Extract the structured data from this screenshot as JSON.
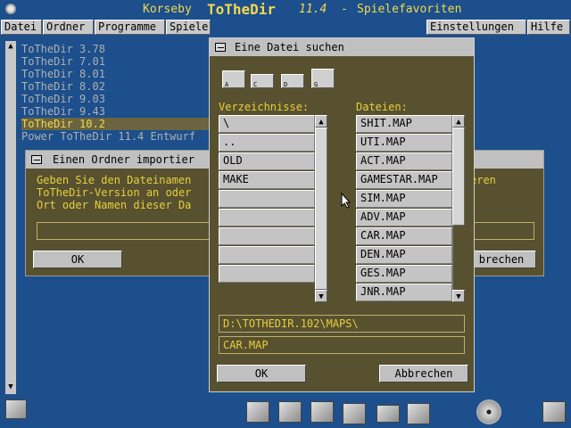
{
  "window": {
    "app_name": "Korseby",
    "product": "ToTheDir",
    "version": "11.4",
    "separator": "-",
    "subtitle": "Spielefavoriten"
  },
  "menu": {
    "left": [
      "Datei",
      "Ordner",
      "Programme",
      "Spiele"
    ],
    "right": [
      "Einstellungen",
      "Hilfe"
    ]
  },
  "main_list": {
    "items": [
      "ToTheDir 3.78",
      "ToTheDir 7.01",
      "ToTheDir 8.01",
      "ToTheDir 8.02",
      "ToTheDir 9.03",
      "ToTheDir 9.43",
      "ToTheDir 10.2",
      "Power ToTheDir 11.4 Entwurf"
    ],
    "selected_index": 6,
    "scroll_up": "▲",
    "scroll_down": "▼"
  },
  "import_dialog": {
    "title": "Einen Ordner importier",
    "text_lines": [
      "Geben Sie den Dateinamen",
      "ToTheDir-Version an oder",
      "Ort oder Namen dieser Da"
    ],
    "text_tail": "eren",
    "ok_label": "OK",
    "cancel_label": "brechen"
  },
  "file_dialog": {
    "title": "Eine Datei suchen",
    "drives": [
      {
        "icon": "floppy-drive-icon",
        "letter": "A"
      },
      {
        "icon": "hard-drive-icon",
        "letter": "C"
      },
      {
        "icon": "hard-drive-icon",
        "letter": "D"
      },
      {
        "icon": "cdrom-drive-icon",
        "letter": "G"
      }
    ],
    "dirs_label": "Verzeichnisse:",
    "files_label": "Dateien:",
    "directories": [
      "\\",
      "..",
      "OLD",
      "MAKE",
      "",
      "",
      "",
      "",
      ""
    ],
    "files": [
      "SHIT.MAP",
      "UTI.MAP",
      "ACT.MAP",
      "GAMESTAR.MAP",
      "SIM.MAP",
      "ADV.MAP",
      "CAR.MAP",
      "DEN.MAP",
      "GES.MAP",
      "JNR.MAP"
    ],
    "path": "D:\\TOTHEDIR.102\\MAPS\\",
    "filename": "CAR.MAP",
    "ok_label": "OK",
    "cancel_label": "Abbrechen",
    "scroll_up": "▲",
    "scroll_down": "▼"
  },
  "taskbar": {
    "icons": [
      "computer-icon",
      "folder-open-icon",
      "folder-icon",
      "documents-icon",
      "tools-icon",
      "printer-icon",
      "puzzle-icon",
      "cd-icon",
      "windows-icon"
    ]
  },
  "colors": {
    "desktop": "#1c4f8c",
    "accent_yellow": "#f3d94a",
    "dialog_bg": "#575130"
  }
}
